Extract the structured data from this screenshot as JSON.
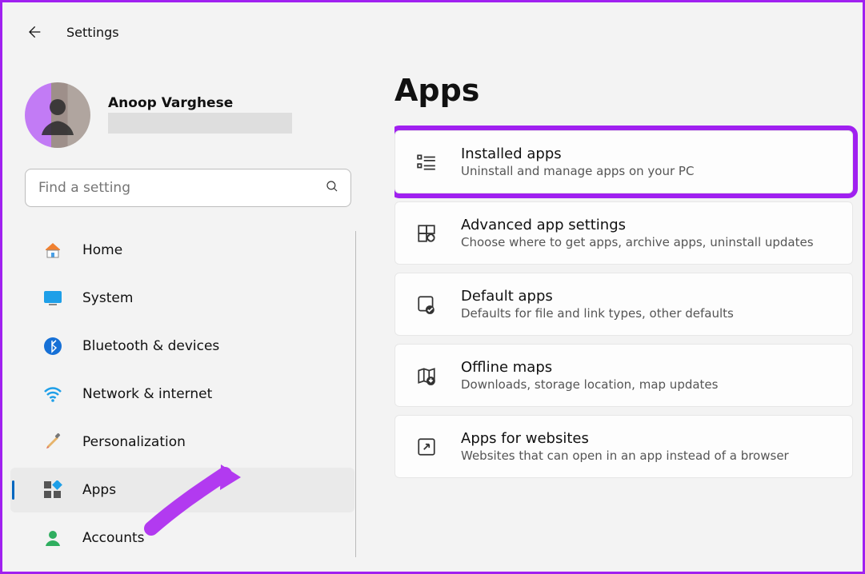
{
  "header": {
    "title": "Settings"
  },
  "profile": {
    "name": "Anoop Varghese"
  },
  "search": {
    "placeholder": "Find a setting"
  },
  "sidebar": {
    "items": [
      {
        "label": "Home"
      },
      {
        "label": "System"
      },
      {
        "label": "Bluetooth & devices"
      },
      {
        "label": "Network & internet"
      },
      {
        "label": "Personalization"
      },
      {
        "label": "Apps"
      },
      {
        "label": "Accounts"
      }
    ]
  },
  "page": {
    "title": "Apps"
  },
  "cards": [
    {
      "title": "Installed apps",
      "sub": "Uninstall and manage apps on your PC"
    },
    {
      "title": "Advanced app settings",
      "sub": "Choose where to get apps, archive apps, uninstall updates"
    },
    {
      "title": "Default apps",
      "sub": "Defaults for file and link types, other defaults"
    },
    {
      "title": "Offline maps",
      "sub": "Downloads, storage location, map updates"
    },
    {
      "title": "Apps for websites",
      "sub": "Websites that can open in an app instead of a browser"
    }
  ]
}
